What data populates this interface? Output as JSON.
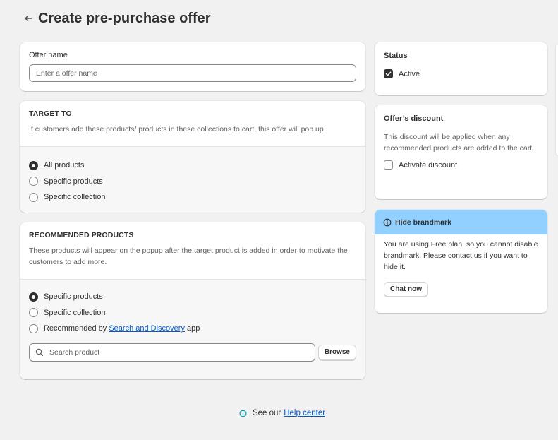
{
  "header": {
    "title": "Create pre-purchase offer"
  },
  "offer_name": {
    "label": "Offer name",
    "placeholder": "Enter a offer name"
  },
  "target": {
    "heading": "TARGET TO",
    "description": "If customers add these products/ products in these collections to cart, this offer will pop up.",
    "options": [
      "All products",
      "Specific products",
      "Specific collection"
    ],
    "selected": "All products"
  },
  "recommended": {
    "heading": "RECOMMENDED PRODUCTS",
    "description": "These products will appear on the popup after the target product is added in order to motivate the customers to add more.",
    "options": [
      "Specific products",
      "Specific collection"
    ],
    "selected": "Specific products",
    "option3_prefix": "Recommended by",
    "option3_link": "Search and Discovery",
    "option3_suffix": "app",
    "search_placeholder": "Search product",
    "browse_label": "Browse"
  },
  "status": {
    "heading": "Status",
    "checkbox_label": "Active",
    "checked": true
  },
  "discount": {
    "heading": "Offer’s discount",
    "description": "This discount will be applied when any recommended products are added to the cart.",
    "checkbox_label": "Activate discount",
    "checked": false
  },
  "brandmark": {
    "heading": "Hide brandmark",
    "body": "You are using Free plan, so you cannot disable brandmark. Please contact us if you want to hide it.",
    "button_label": "Chat now"
  },
  "footer": {
    "prefix": "See our",
    "link": "Help center"
  },
  "colors": {
    "banner": "#91d0ff",
    "link": "#005bd3",
    "background": "#f1f1f1",
    "info_icon": "#00a0ac"
  }
}
